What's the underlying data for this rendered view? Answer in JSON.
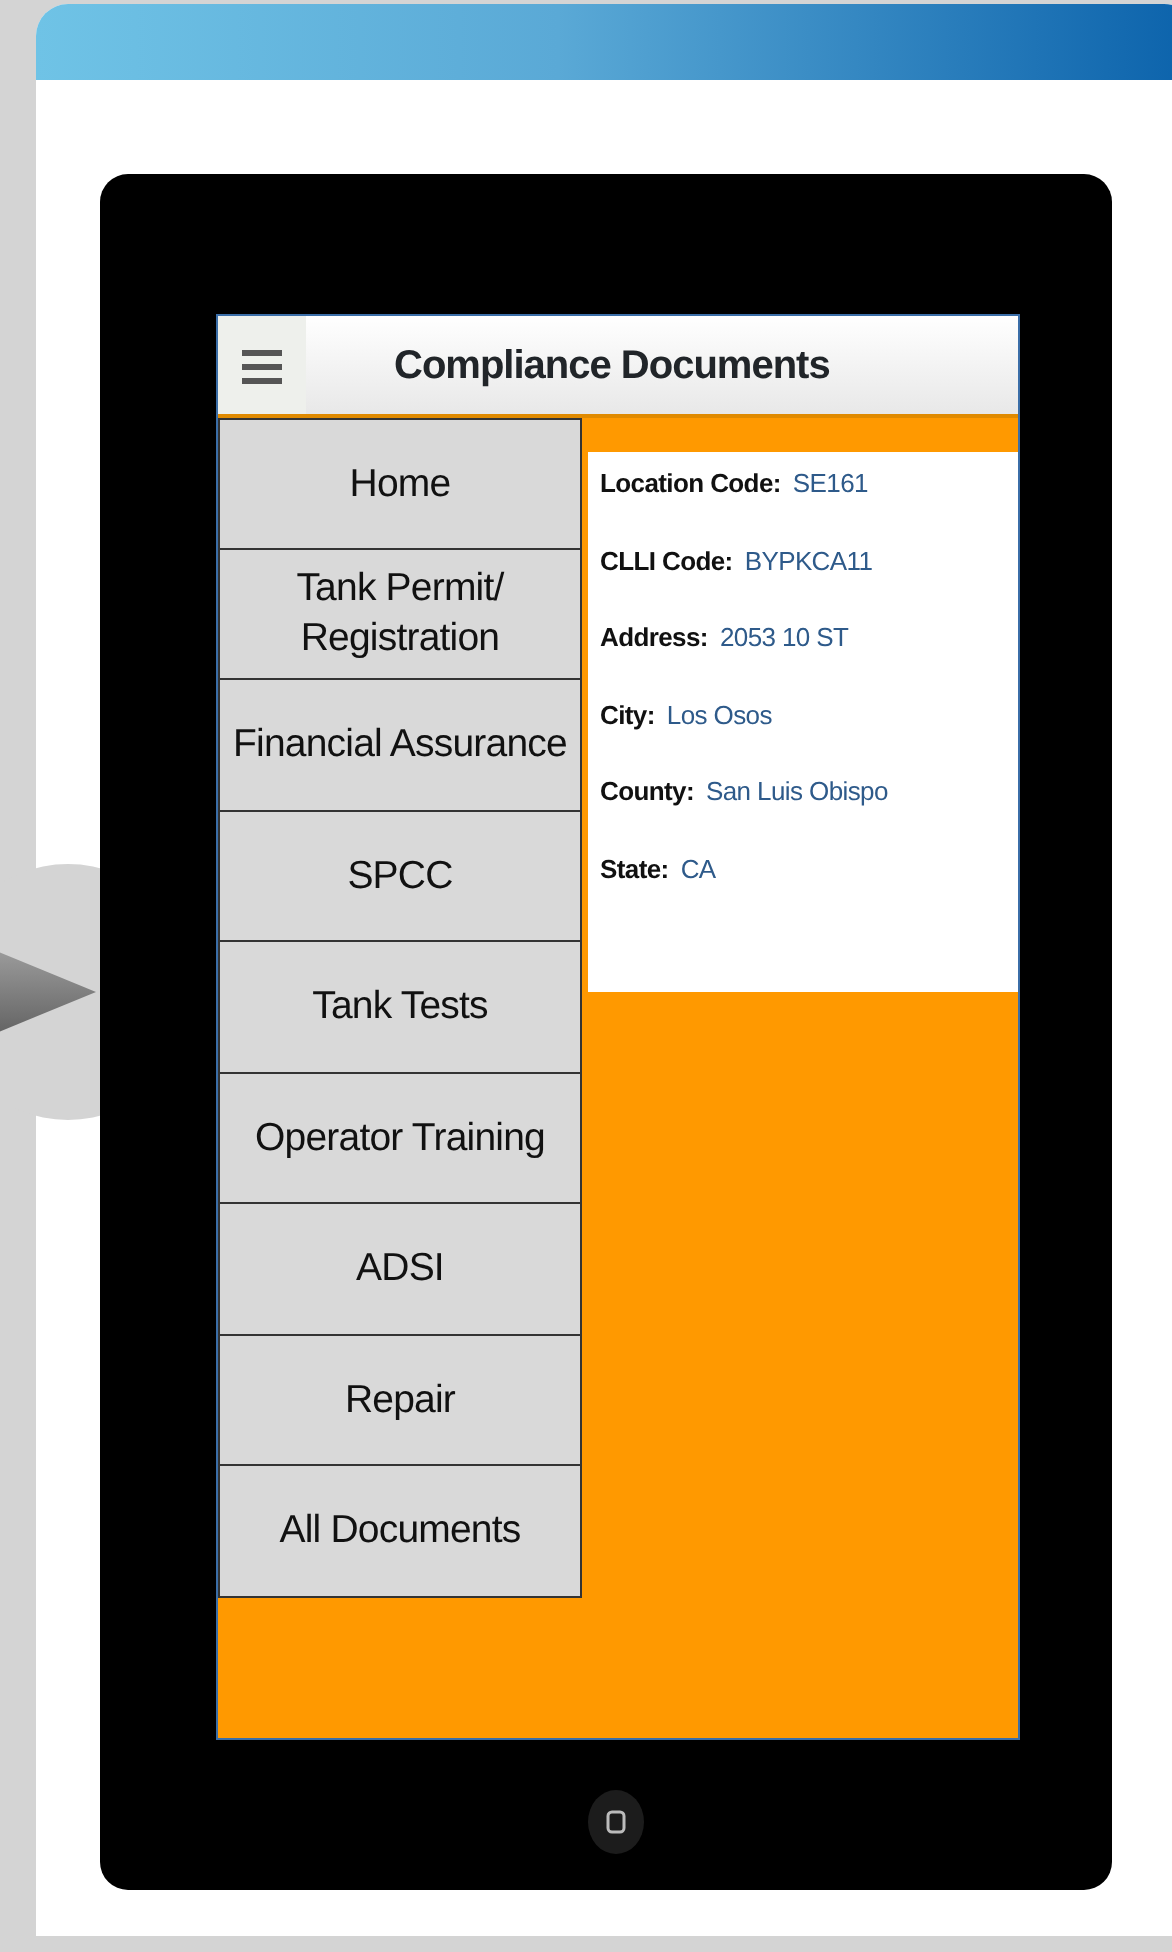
{
  "screen": {
    "title": "Compliance Documents"
  },
  "menu": [
    {
      "label": "Home"
    },
    {
      "label": "Tank Permit/ Registration"
    },
    {
      "label": "Financial Assurance"
    },
    {
      "label": "SPCC"
    },
    {
      "label": "Tank Tests"
    },
    {
      "label": "Operator Training"
    },
    {
      "label": "ADSI"
    },
    {
      "label": "Repair"
    },
    {
      "label": "All Documents"
    }
  ],
  "details": [
    {
      "label": "Location Code:",
      "value": "SE161"
    },
    {
      "label": "CLLI Code:",
      "value": "BYPKCA11"
    },
    {
      "label": "Address:",
      "value": "2053 10 ST"
    },
    {
      "label": "City:",
      "value": "Los Osos"
    },
    {
      "label": "County:",
      "value": "San Luis Obispo"
    },
    {
      "label": "State:",
      "value": "CA"
    }
  ]
}
